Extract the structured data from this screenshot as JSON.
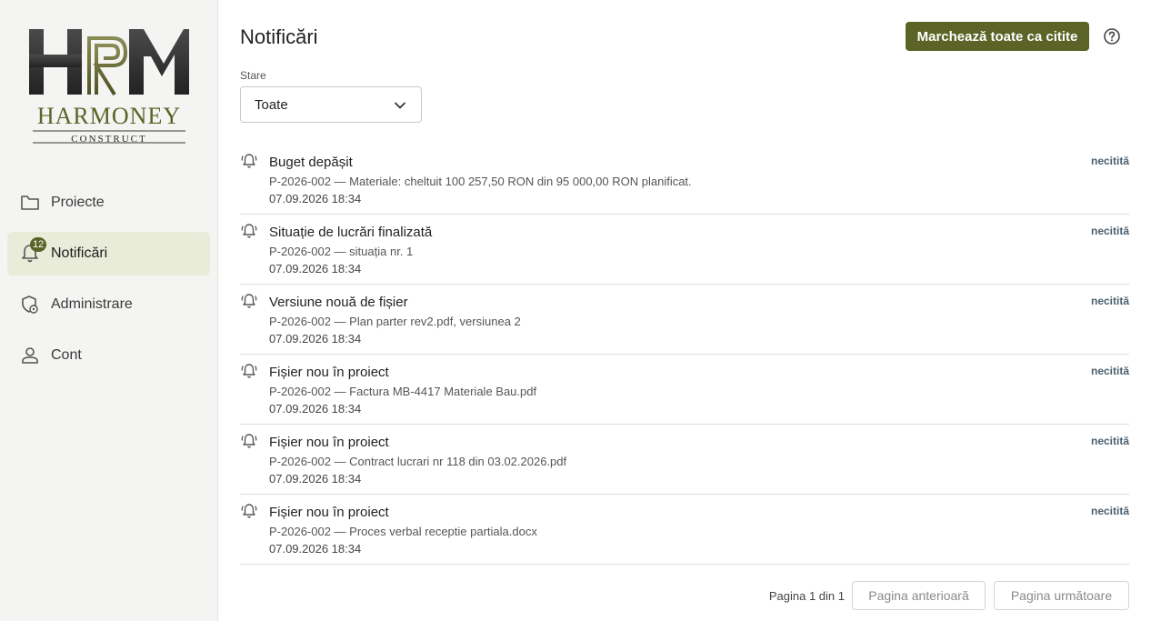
{
  "brand": {
    "logo_letters": "HRM",
    "logo_name": "HARMONEY",
    "logo_sub": "CONSTRUCT",
    "colors": {
      "olive": "#5b6326",
      "dark": "#3a3a3a"
    }
  },
  "sidebar": {
    "items": [
      {
        "label": "Proiecte",
        "icon": "folder-icon",
        "active": false
      },
      {
        "label": "Notificări",
        "icon": "bell-icon",
        "active": true,
        "badge": "12"
      },
      {
        "label": "Administrare",
        "icon": "admin-shield-icon",
        "active": false
      },
      {
        "label": "Cont",
        "icon": "person-icon",
        "active": false
      }
    ]
  },
  "header": {
    "title": "Notificări",
    "mark_all_label": "Marchează toate ca citite",
    "help_icon": "help-icon"
  },
  "filter": {
    "label": "Stare",
    "value": "Toate"
  },
  "notifications": [
    {
      "title": "Buget depășit",
      "desc": "P-2026-002 — Materiale: cheltuit 100 257,50 RON din 95 000,00 RON planificat.",
      "date": "07.09.2026 18:34",
      "status": "necitită"
    },
    {
      "title": "Situație de lucrări finalizată",
      "desc": "P-2026-002 — situația nr. 1",
      "date": "07.09.2026 18:34",
      "status": "necitită"
    },
    {
      "title": "Versiune nouă de fișier",
      "desc": "P-2026-002 — Plan parter rev2.pdf, versiunea 2",
      "date": "07.09.2026 18:34",
      "status": "necitită"
    },
    {
      "title": "Fișier nou în proiect",
      "desc": "P-2026-002 — Factura MB-4417 Materiale Bau.pdf",
      "date": "07.09.2026 18:34",
      "status": "necitită"
    },
    {
      "title": "Fișier nou în proiect",
      "desc": "P-2026-002 — Contract lucrari nr 118 din 03.02.2026.pdf",
      "date": "07.09.2026 18:34",
      "status": "necitită"
    },
    {
      "title": "Fișier nou în proiect",
      "desc": "P-2026-002 — Proces verbal receptie partiala.docx",
      "date": "07.09.2026 18:34",
      "status": "necitită"
    }
  ],
  "pager": {
    "info": "Pagina 1 din 1",
    "prev_label": "Pagina anterioară",
    "next_label": "Pagina următoare"
  }
}
